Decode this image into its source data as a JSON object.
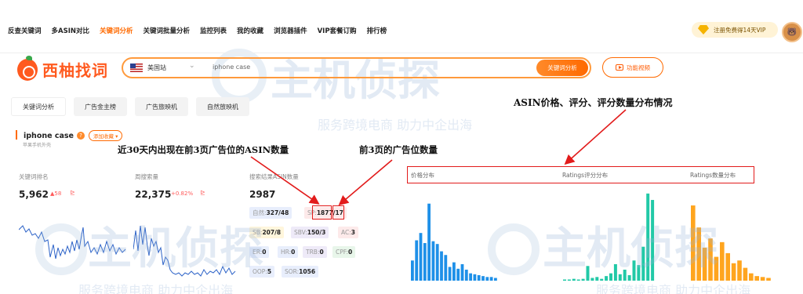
{
  "nav": {
    "items": [
      "反查关键词",
      "多ASIN对比",
      "关键词分析",
      "关键词批量分析",
      "监控列表",
      "我的收藏",
      "浏览器插件",
      "VIP套餐订购",
      "排行榜"
    ],
    "active_index": 2,
    "vip_label": "注册免费得14天VIP"
  },
  "brand": {
    "name": "西柚找词"
  },
  "search": {
    "site": "美国站",
    "value": "iphone case",
    "button": "关键词分析"
  },
  "video_button": "功能视频",
  "tabs": [
    "关键词分析",
    "广告金主榜",
    "广告旅映机",
    "自然放映机"
  ],
  "keyword": {
    "title": "iphone case",
    "add_label": "添加收藏 ▾",
    "subtitle": "苹果手机外壳"
  },
  "metrics": {
    "rank": {
      "label": "关键词排名",
      "value": "5,962",
      "delta": "▲58"
    },
    "search_volume": {
      "label": "周搜索量",
      "value": "22,375",
      "delta": "+0.82%"
    },
    "asin_count": {
      "label": "搜索结果ASIN数量",
      "value": "2987"
    }
  },
  "asin_tags": [
    {
      "k": "自然:",
      "v": "327/48",
      "style": "blue"
    },
    {
      "k": "SP:",
      "v": "1877",
      "v2": "17",
      "style": "pink"
    },
    {
      "k": "SB:",
      "v": "207/8",
      "style": "yellow"
    },
    {
      "k": "SBV:",
      "v": "150/3",
      "style": "purple"
    },
    {
      "k": "AC:",
      "v": "3",
      "style": "pink"
    },
    {
      "k": "ER:",
      "v": "0",
      "style": "blue"
    },
    {
      "k": "HR:",
      "v": "0",
      "style": "blue"
    },
    {
      "k": "TRB:",
      "v": "0",
      "style": "purple"
    },
    {
      "k": "CPF:",
      "v": "0",
      "style": "green"
    },
    {
      "k": "OOP:",
      "v": "5",
      "style": "blue"
    },
    {
      "k": "SOR:",
      "v": "1056",
      "style": "blue"
    }
  ],
  "distribution": {
    "labels": [
      "价格分布",
      "Ratings评分分布",
      "Ratings数量分布"
    ],
    "price_bars": [
      0.22,
      0.44,
      0.52,
      0.41,
      0.84,
      0.43,
      0.4,
      0.32,
      0.28,
      0.15,
      0.2,
      0.13,
      0.18,
      0.12,
      0.08,
      0.07,
      0.06,
      0.05,
      0.04,
      0.04,
      0.03
    ],
    "rating_score_bars": [
      0.01,
      0.01,
      0.02,
      0.01,
      0.02,
      0.16,
      0.03,
      0.04,
      0.02,
      0.05,
      0.08,
      0.18,
      0.07,
      0.12,
      0.06,
      0.22,
      0.17,
      0.37,
      0.95,
      0.88
    ],
    "rating_count_bars": [
      0.82,
      0.58,
      0.36,
      0.46,
      0.26,
      0.42,
      0.3,
      0.19,
      0.22,
      0.14,
      0.08,
      0.05,
      0.04,
      0.03
    ],
    "colors": {
      "price": "#1e90e8",
      "rating_score": "#22c9a7",
      "rating_count": "#ffa51e"
    }
  },
  "annotations": {
    "asin_dist": "ASIN价格、评分、评分数量分布情况",
    "sp_asin": "近30天内出现在前3页广告位的ASIN数量",
    "sp_slots": "前3页的广告位数量"
  },
  "watermark": {
    "text": "主机侦探",
    "slogan": "服务跨境电商 助力中企出海"
  },
  "colors": {
    "accent": "#ff6a00",
    "annotation": "#e21b1b"
  }
}
